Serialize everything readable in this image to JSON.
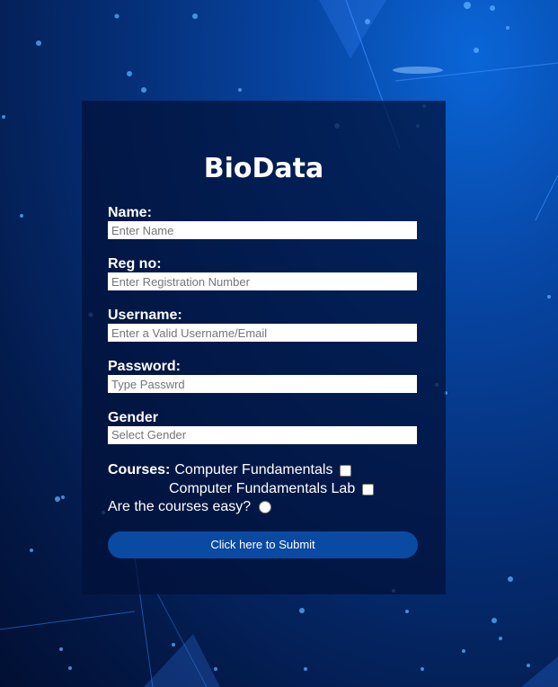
{
  "form": {
    "title": "BioData",
    "name_label": "Name:",
    "name_placeholder": "Enter Name",
    "regno_label": "Reg no:",
    "regno_placeholder": "Enter Registration Number",
    "username_label": "Username:",
    "username_placeholder": "Enter a Valid Username/Email",
    "password_label": "Password:",
    "password_placeholder": "Type Passwrd",
    "gender_label": "Gender",
    "gender_value": "Select Gender",
    "courses_label": "Courses:",
    "course_1": "Computer Fundamentals",
    "course_2": "Computer Fundamentals Lab",
    "easy_question": "Are the courses easy?",
    "submit_label": "Click here to Submit"
  },
  "colors": {
    "background": "#05307a",
    "panel": "#021038",
    "button": "#0b4aa2"
  }
}
